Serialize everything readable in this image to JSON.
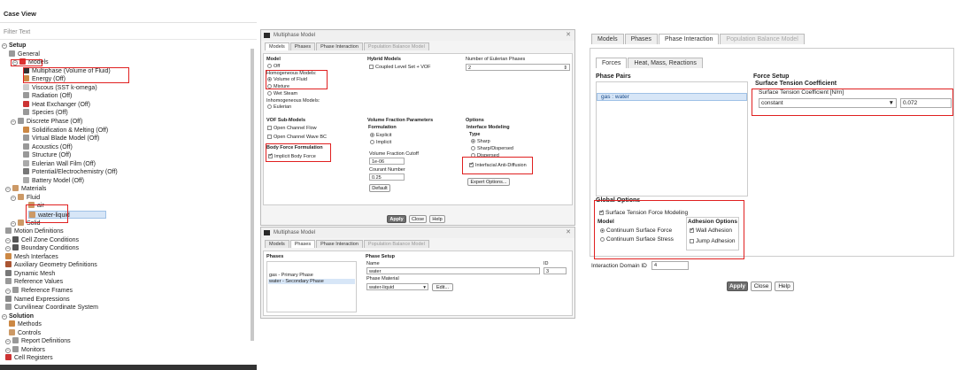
{
  "case_view": {
    "title": "Case View",
    "filter_placeholder": "Filter Text",
    "tree": [
      {
        "label": "Setup",
        "bold": true
      },
      {
        "label": "General"
      },
      {
        "label": "Models"
      },
      {
        "label": "Multiphase (Volume of Fluid)"
      },
      {
        "label": "Energy (Off)"
      },
      {
        "label": "Viscous (SST k-omega)"
      },
      {
        "label": "Radiation (Off)"
      },
      {
        "label": "Heat Exchanger (Off)"
      },
      {
        "label": "Species (Off)"
      },
      {
        "label": "Discrete Phase (Off)"
      },
      {
        "label": "Solidification & Melting (Off)"
      },
      {
        "label": "Virtual Blade Model (Off)"
      },
      {
        "label": "Acoustics (Off)"
      },
      {
        "label": "Structure (Off)"
      },
      {
        "label": "Eulerian Wall Film (Off)"
      },
      {
        "label": "Potential/Electrochemistry (Off)"
      },
      {
        "label": "Battery Model (Off)"
      },
      {
        "label": "Materials"
      },
      {
        "label": "Fluid"
      },
      {
        "label": "air"
      },
      {
        "label": "water-liquid"
      },
      {
        "label": "Solid"
      },
      {
        "label": "Motion Definitions"
      },
      {
        "label": "Cell Zone Conditions"
      },
      {
        "label": "Boundary Conditions"
      },
      {
        "label": "Mesh Interfaces"
      },
      {
        "label": "Auxiliary Geometry Definitions"
      },
      {
        "label": "Dynamic Mesh"
      },
      {
        "label": "Reference Values"
      },
      {
        "label": "Reference Frames"
      },
      {
        "label": "Named Expressions"
      },
      {
        "label": "Curvilinear Coordinate System"
      },
      {
        "label": "Solution",
        "bold": true
      },
      {
        "label": "Methods"
      },
      {
        "label": "Controls"
      },
      {
        "label": "Report Definitions"
      },
      {
        "label": "Monitors"
      },
      {
        "label": "Cell Registers"
      }
    ]
  },
  "dlg1": {
    "title": "Multiphase Model",
    "tabs": [
      "Models",
      "Phases",
      "Phase Interaction",
      "Population Balance Model"
    ],
    "model_label": "Model",
    "off": "Off",
    "homog": "Homogeneous Models:",
    "vof": "Volume of Fluid",
    "mixture": "Mixture",
    "wetsteam": "Wet Steam",
    "inhomog": "Inhomogeneous Models:",
    "eulerian": "Eulerian",
    "hybrid": "Hybrid Models",
    "coupled": "Coupled Level Set + VOF",
    "num_euler": "Number of Eulerian Phases",
    "num_euler_val": "2",
    "vof_sub": "VOF Sub-Models",
    "open_flow": "Open Channel Flow",
    "open_wave": "Open Channel Wave BC",
    "vfp": "Volume Fraction Parameters",
    "formulation": "Formulation",
    "explicit": "Explicit",
    "implicit": "Implicit",
    "vf_cutoff": "Volume Fraction Cutoff",
    "vf_cutoff_val": "1e-06",
    "courant": "Courant Number",
    "courant_val": "0.25",
    "default": "Default",
    "options": "Options",
    "interface": "Interface Modeling",
    "type": "Type",
    "sharp": "Sharp",
    "sharp_disp": "Sharp/Dispersed",
    "dispersed": "Dispersed",
    "anti_diff": "Interfacial Anti-Diffusion",
    "export": "Expert Options...",
    "body_force": "Body Force Formulation",
    "implicit_bf": "Implicit Body Force",
    "apply": "Apply",
    "close": "Close",
    "help": "Help"
  },
  "dlg2": {
    "title": "Multiphase Model",
    "tabs": [
      "Models",
      "Phases",
      "Phase Interaction",
      "Population Balance Model"
    ],
    "phases": "Phases",
    "phase_list": [
      "gas - Primary Phase",
      "water - Secondary Phase"
    ],
    "phase_setup": "Phase Setup",
    "name": "Name",
    "name_val": "water",
    "id": "ID",
    "id_val": "3",
    "phase_material": "Phase Material",
    "material_val": "water-liquid",
    "edit": "Edit..."
  },
  "dlg3": {
    "tabs": [
      "Models",
      "Phases",
      "Phase Interaction",
      "Population Balance Model"
    ],
    "subtabs": [
      "Forces",
      "Heat, Mass, Reactions"
    ],
    "phase_pairs": "Phase Pairs",
    "pair": "gas : water",
    "force_setup": "Force Setup",
    "stc": "Surface Tension Coefficient",
    "stc_unit": "Surface Tension Coefficient [N/m]",
    "method": "constant",
    "value": "0.072",
    "global": "Global Options",
    "stfm": "Surface Tension Force Modeling",
    "model": "Model",
    "csf": "Continuum Surface Force",
    "css": "Continuum Surface Stress",
    "adhesion": "Adhesion Options",
    "wall_adh": "Wall Adhesion",
    "jump_adh": "Jump Adhesion",
    "domain_id": "Interaction Domain ID",
    "domain_val": "4",
    "apply": "Apply",
    "close": "Close",
    "help": "Help"
  },
  "colors": {
    "highlight": "#e02020",
    "accent": "#2a6ebb"
  }
}
